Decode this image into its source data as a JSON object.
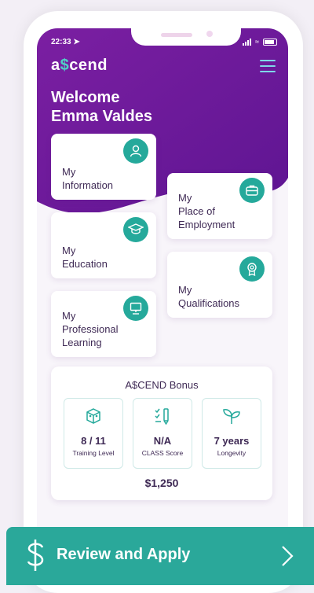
{
  "status": {
    "time": "22:33"
  },
  "app": {
    "logo_prefix": "a",
    "logo_dollar": "$",
    "logo_suffix": "cend"
  },
  "welcome": {
    "line1": "Welcome",
    "line2": "Emma Valdes"
  },
  "cards": [
    {
      "id": "information",
      "line1": "My",
      "line2": "Information",
      "line3": "",
      "icon": "user-icon"
    },
    {
      "id": "employment",
      "line1": "My",
      "line2": "Place of",
      "line3": "Employment",
      "icon": "briefcase-icon"
    },
    {
      "id": "education",
      "line1": "My",
      "line2": "Education",
      "line3": "",
      "icon": "graduation-cap-icon"
    },
    {
      "id": "qualifications",
      "line1": "My",
      "line2": "Qualifications",
      "line3": "",
      "icon": "award-icon"
    },
    {
      "id": "learning",
      "line1": "My",
      "line2": "Professional",
      "line3": "Learning",
      "icon": "presentation-icon"
    }
  ],
  "bonus": {
    "title": "A$CEND Bonus",
    "metrics": [
      {
        "value": "8 / 11",
        "label": "Training Level",
        "icon": "blocks-icon"
      },
      {
        "value": "N/A",
        "label": "CLASS Score",
        "icon": "checklist-pencil-icon"
      },
      {
        "value": "7 years",
        "label": "Longevity",
        "icon": "sprout-icon"
      }
    ],
    "amount": "$1,250"
  },
  "cta": {
    "label": "Review and Apply",
    "icon": "dollar-sign-icon",
    "arrow": "chevron-right-icon"
  },
  "colors": {
    "purple": "#6a1b9a",
    "teal": "#2aa89a",
    "text": "#3f2a55"
  }
}
